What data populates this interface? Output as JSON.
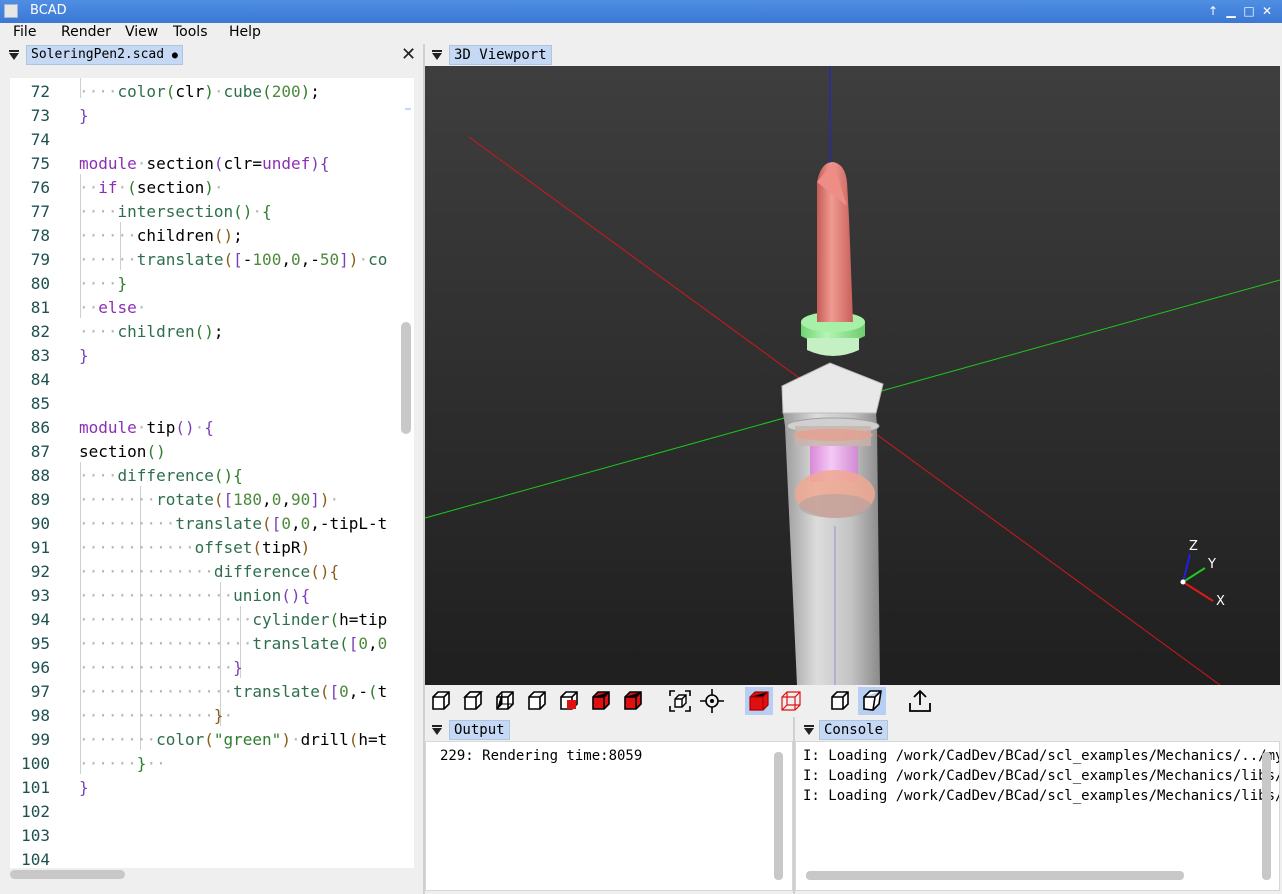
{
  "window": {
    "title": "BCAD"
  },
  "menu": [
    "File",
    "Render",
    "View",
    "Tools",
    "Help"
  ],
  "editor": {
    "tab_label": "SoleringPen2.scad",
    "modified_marker": "●",
    "close": "✕",
    "lines": [
      {
        "n": "72"
      },
      {
        "n": "73"
      },
      {
        "n": "74"
      },
      {
        "n": "75"
      },
      {
        "n": "76"
      },
      {
        "n": "77"
      },
      {
        "n": "78"
      },
      {
        "n": "79"
      },
      {
        "n": "80"
      },
      {
        "n": "81"
      },
      {
        "n": "82"
      },
      {
        "n": "83"
      },
      {
        "n": "84"
      },
      {
        "n": "85"
      },
      {
        "n": "86"
      },
      {
        "n": "87"
      },
      {
        "n": "88"
      },
      {
        "n": "89"
      },
      {
        "n": "90"
      },
      {
        "n": "91"
      },
      {
        "n": "92"
      },
      {
        "n": "93"
      },
      {
        "n": "94"
      },
      {
        "n": "95"
      },
      {
        "n": "96"
      },
      {
        "n": "97"
      },
      {
        "n": "98"
      },
      {
        "n": "99"
      },
      {
        "n": "100"
      },
      {
        "n": "101"
      },
      {
        "n": "102"
      },
      {
        "n": "103"
      },
      {
        "n": "104"
      }
    ],
    "code": [
      [
        [
          "d",
          "····"
        ],
        [
          "f",
          "color"
        ],
        [
          "p2",
          "("
        ],
        [
          "",
          "clr"
        ],
        [
          "p2",
          ")"
        ],
        [
          "d",
          "·"
        ],
        [
          "f",
          "cube"
        ],
        [
          "p2",
          "("
        ],
        [
          "n",
          "200"
        ],
        [
          "p2",
          ")"
        ],
        [
          "",
          ";"
        ]
      ],
      [
        [
          "p1",
          "}"
        ]
      ],
      [],
      [
        [
          "k",
          "module"
        ],
        [
          "d",
          "·"
        ],
        [
          "",
          "section"
        ],
        [
          "p1",
          "("
        ],
        [
          "",
          "clr"
        ],
        [
          "",
          "="
        ],
        [
          "k",
          "undef"
        ],
        [
          "p1",
          ")"
        ],
        [
          "p1",
          "{"
        ]
      ],
      [
        [
          "d",
          "··"
        ],
        [
          "k",
          "if"
        ],
        [
          "d",
          "·"
        ],
        [
          "p2",
          "("
        ],
        [
          "",
          "section"
        ],
        [
          "p2",
          ")"
        ],
        [
          "d",
          "·"
        ]
      ],
      [
        [
          "d",
          "····"
        ],
        [
          "f",
          "intersection"
        ],
        [
          "p2",
          "()"
        ],
        [
          "d",
          "·"
        ],
        [
          "p2",
          "{"
        ]
      ],
      [
        [
          "d",
          "······"
        ],
        [
          "",
          "children"
        ],
        [
          "p3",
          "()"
        ],
        [
          "",
          ";"
        ]
      ],
      [
        [
          "d",
          "······"
        ],
        [
          "f",
          "translate"
        ],
        [
          "p3",
          "("
        ],
        [
          "p1",
          "["
        ],
        [
          "",
          "-"
        ],
        [
          "n",
          "100"
        ],
        [
          "",
          ","
        ],
        [
          "n",
          "0"
        ],
        [
          "",
          ","
        ],
        [
          "",
          "-"
        ],
        [
          "n",
          "50"
        ],
        [
          "p1",
          "]"
        ],
        [
          "p3",
          ")"
        ],
        [
          "d",
          "·"
        ],
        [
          "f",
          "co"
        ]
      ],
      [
        [
          "d",
          "····"
        ],
        [
          "p2",
          "}"
        ]
      ],
      [
        [
          "d",
          "··"
        ],
        [
          "k",
          "else"
        ],
        [
          "d",
          "·"
        ]
      ],
      [
        [
          "d",
          "····"
        ],
        [
          "f",
          "children"
        ],
        [
          "p2",
          "()"
        ],
        [
          "",
          ";"
        ]
      ],
      [
        [
          "p1",
          "}"
        ]
      ],
      [],
      [],
      [
        [
          "k",
          "module"
        ],
        [
          "d",
          "·"
        ],
        [
          "",
          "tip"
        ],
        [
          "p1",
          "()"
        ],
        [
          "d",
          "·"
        ],
        [
          "p1",
          "{"
        ]
      ],
      [
        [
          "",
          "section"
        ],
        [
          "p2",
          "()"
        ]
      ],
      [
        [
          "d",
          "····"
        ],
        [
          "f",
          "difference"
        ],
        [
          "p2",
          "()"
        ],
        [
          "p2",
          "{"
        ]
      ],
      [
        [
          "d",
          "········"
        ],
        [
          "f",
          "rotate"
        ],
        [
          "p3",
          "("
        ],
        [
          "p1",
          "["
        ],
        [
          "n",
          "180"
        ],
        [
          "",
          ","
        ],
        [
          "n",
          "0"
        ],
        [
          "",
          ","
        ],
        [
          "n",
          "90"
        ],
        [
          "p1",
          "]"
        ],
        [
          "p3",
          ")"
        ],
        [
          "d",
          "·"
        ]
      ],
      [
        [
          "d",
          "··········"
        ],
        [
          "f",
          "translate"
        ],
        [
          "p3",
          "("
        ],
        [
          "p1",
          "["
        ],
        [
          "n",
          "0"
        ],
        [
          "",
          ","
        ],
        [
          "n",
          "0"
        ],
        [
          "",
          ","
        ],
        [
          "",
          "-tipL-t"
        ]
      ],
      [
        [
          "d",
          "············"
        ],
        [
          "f",
          "offset"
        ],
        [
          "p3",
          "("
        ],
        [
          "",
          "tipR"
        ],
        [
          "p3",
          ")"
        ]
      ],
      [
        [
          "d",
          "··············"
        ],
        [
          "f",
          "difference"
        ],
        [
          "p3",
          "()"
        ],
        [
          "p3",
          "{"
        ]
      ],
      [
        [
          "d",
          "················"
        ],
        [
          "f",
          "union"
        ],
        [
          "p1",
          "()"
        ],
        [
          "p1",
          "{"
        ]
      ],
      [
        [
          "d",
          "··················"
        ],
        [
          "f",
          "cylinder"
        ],
        [
          "p2",
          "("
        ],
        [
          "",
          "h=tip"
        ]
      ],
      [
        [
          "d",
          "··················"
        ],
        [
          "f",
          "translate"
        ],
        [
          "p2",
          "("
        ],
        [
          "p1",
          "["
        ],
        [
          "n",
          "0"
        ],
        [
          "",
          ","
        ],
        [
          "n",
          "0"
        ]
      ],
      [
        [
          "d",
          "················"
        ],
        [
          "p1",
          "}"
        ]
      ],
      [
        [
          "d",
          "················"
        ],
        [
          "f",
          "translate"
        ],
        [
          "p3",
          "("
        ],
        [
          "p1",
          "["
        ],
        [
          "n",
          "0"
        ],
        [
          "",
          ","
        ],
        [
          "",
          "-"
        ],
        [
          "p2",
          "("
        ],
        [
          "",
          "t"
        ]
      ],
      [
        [
          "d",
          "··············"
        ],
        [
          "p3",
          "}"
        ],
        [
          "d",
          "·"
        ]
      ],
      [
        [
          "d",
          "········"
        ],
        [
          "f",
          "color"
        ],
        [
          "p3",
          "("
        ],
        [
          "s",
          "\"green\""
        ],
        [
          "p3",
          ")"
        ],
        [
          "d",
          "·"
        ],
        [
          "",
          "drill"
        ],
        [
          "p3",
          "("
        ],
        [
          "",
          "h=t"
        ]
      ],
      [
        [
          "d",
          "······"
        ],
        [
          "p2",
          "}"
        ],
        [
          "d",
          "··"
        ]
      ],
      [
        [
          "p1",
          "}"
        ]
      ],
      [],
      [],
      []
    ]
  },
  "viewport": {
    "tab_label": "3D Viewport",
    "axes": [
      "Z",
      "Y",
      "X"
    ]
  },
  "toolbar": {
    "icons": [
      "view-iso-icon",
      "view-top-icon",
      "view-bottom-icon",
      "view-left-icon",
      "view-right-icon",
      "view-front-icon",
      "view-back-icon",
      "fit-all-icon",
      "center-icon",
      "solid-mode-icon",
      "wireframe-mode-icon",
      "perspective-icon",
      "orthographic-icon",
      "export-icon"
    ]
  },
  "output": {
    "tab_label": "Output",
    "lines": [
      "229: Rendering time:8059"
    ]
  },
  "console": {
    "tab_label": "Console",
    "lines": [
      "I: Loading /work/CadDev/BCad/scl_examples/Mechanics/../my",
      "I: Loading /work/CadDev/BCad/scl_examples/Mechanics/libs/",
      "I: Loading /work/CadDev/BCad/scl_examples/Mechanics/libs/"
    ]
  },
  "colors": {
    "selection_tab": "#c5d9f5",
    "viewport_bg": "#2f2f2f",
    "pen_tip": "#e8807a",
    "pen_ring": "#9de89d",
    "pen_body": "#d9d9d9"
  }
}
